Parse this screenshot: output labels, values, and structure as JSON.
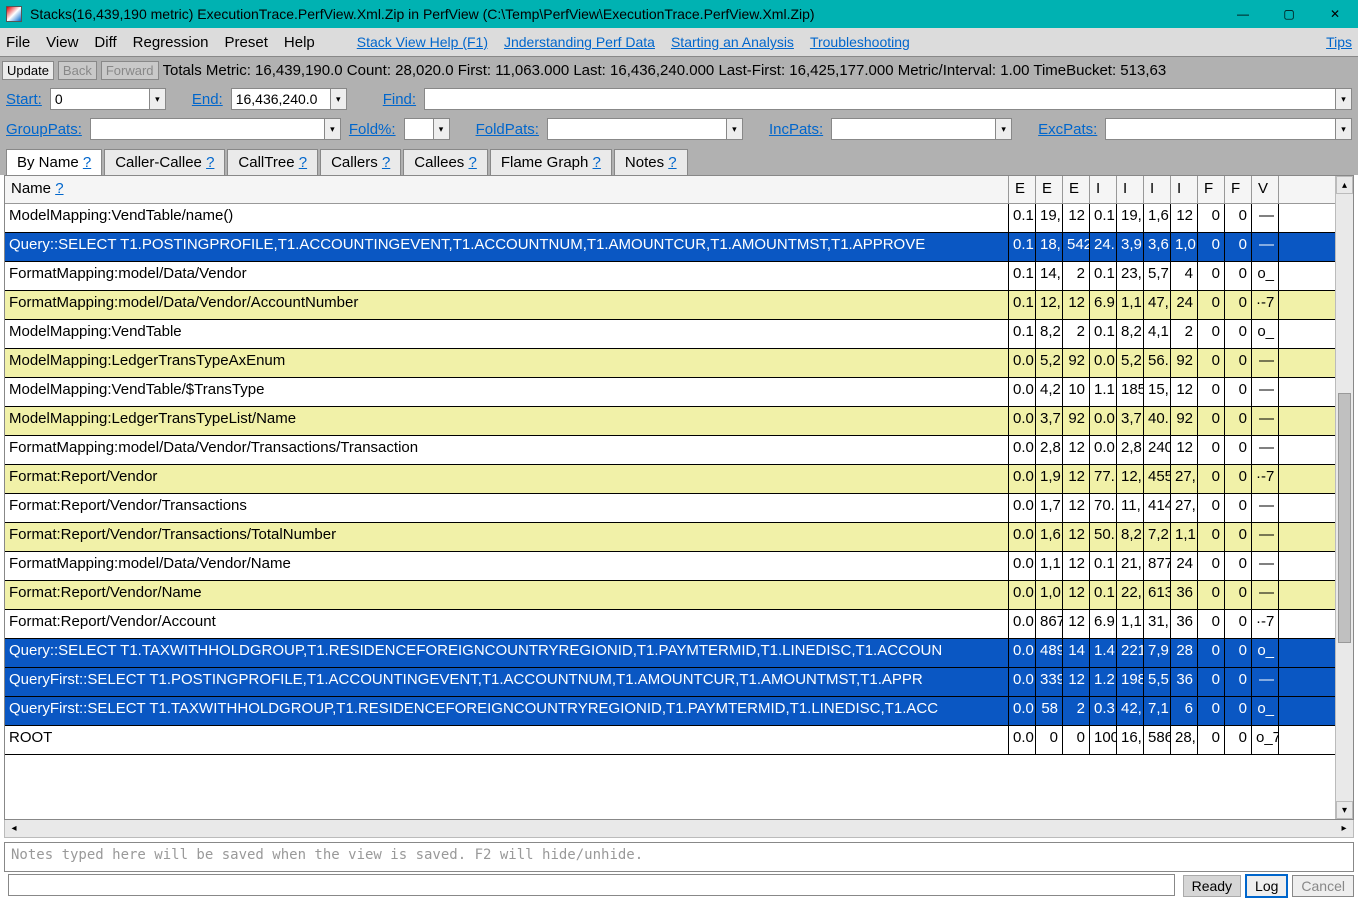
{
  "window": {
    "title": "Stacks(16,439,190 metric) ExecutionTrace.PerfView.Xml.Zip in PerfView (C:\\Temp\\PerfView\\ExecutionTrace.PerfView.Xml.Zip)"
  },
  "menu": {
    "file": "File",
    "view": "View",
    "diff": "Diff",
    "regression": "Regression",
    "preset": "Preset",
    "help": "Help",
    "links": {
      "stack": "Stack View Help (F1)",
      "understand": "Jnderstanding Perf Data",
      "starting": "Starting an Analysis",
      "trouble": "Troubleshooting",
      "tips": "Tips"
    }
  },
  "toolbar": {
    "update": "Update",
    "back": "Back",
    "forward": "Forward",
    "stats": "Totals Metric: 16,439,190.0   Count: 28,020.0   First: 11,063.000  Last: 16,436,240.000   Last-First: 16,425,177.000   Metric/Interval: 1.00   TimeBucket: 513,63"
  },
  "filters1": {
    "start_label": "Start:",
    "start_val": "0",
    "end_label": "End:",
    "end_val": "16,436,240.0",
    "find_label": "Find:",
    "find_val": ""
  },
  "filters2": {
    "group_label": "GroupPats:",
    "foldpct_label": "Fold%:",
    "foldpats_label": "FoldPats:",
    "incpats_label": "IncPats:",
    "excpats_label": "ExcPats:"
  },
  "tabs": {
    "byname": "By Name",
    "callercallee": "Caller-Callee",
    "calltree": "CallTree",
    "callers": "Callers",
    "callees": "Callees",
    "flame": "Flame Graph",
    "notes": "Notes",
    "q": "?"
  },
  "grid": {
    "headers": {
      "name": "Name",
      "q": "?",
      "c1": "E",
      "c2": "E",
      "c3": "E",
      "c4": "I",
      "c5": "I",
      "c6": "I",
      "c7": "I",
      "c8": "F",
      "c9": "F",
      "c10": "V"
    },
    "rows": [
      {
        "name": "ModelMapping:VendTable/name()",
        "c": [
          "0.1",
          "19,",
          "12",
          "0.1",
          "19,",
          "1,6",
          "12",
          "0",
          "0",
          "—"
        ],
        "alt": false,
        "sel": false
      },
      {
        "name": "Query::SELECT T1.POSTINGPROFILE,T1.ACCOUNTINGEVENT,T1.ACCOUNTNUM,T1.AMOUNTCUR,T1.AMOUNTMST,T1.APPROVE",
        "c": [
          "0.1",
          "18,",
          "542",
          "24.",
          "3,9",
          "3,6",
          "1,0",
          "0",
          "0",
          "—"
        ],
        "alt": true,
        "sel": true
      },
      {
        "name": "FormatMapping:model/Data/Vendor",
        "c": [
          "0.1",
          "14,",
          "2",
          "0.1",
          "23,",
          "5,7",
          "4",
          "0",
          "0",
          "o_"
        ],
        "alt": false,
        "sel": false
      },
      {
        "name": "FormatMapping:model/Data/Vendor/AccountNumber",
        "c": [
          "0.1",
          "12,",
          "12",
          "6.9",
          "1,1",
          "47,",
          "24",
          "0",
          "0",
          "·-7"
        ],
        "alt": true,
        "sel": false
      },
      {
        "name": "ModelMapping:VendTable",
        "c": [
          "0.1",
          "8,2",
          "2",
          "0.1",
          "8,2",
          "4,1",
          "2",
          "0",
          "0",
          "o_"
        ],
        "alt": false,
        "sel": false
      },
      {
        "name": "ModelMapping:LedgerTransTypeAxEnum",
        "c": [
          "0.0",
          "5,2",
          "92",
          "0.0",
          "5,2",
          "56.",
          "92",
          "0",
          "0",
          "—"
        ],
        "alt": true,
        "sel": false
      },
      {
        "name": "ModelMapping:VendTable/$TransType",
        "c": [
          "0.0",
          "4,2",
          "10",
          "1.1",
          "185",
          "15,",
          "12",
          "0",
          "0",
          "—"
        ],
        "alt": false,
        "sel": false
      },
      {
        "name": "ModelMapping:LedgerTransTypeList/Name",
        "c": [
          "0.0",
          "3,7",
          "92",
          "0.0",
          "3,7",
          "40.",
          "92",
          "0",
          "0",
          "—"
        ],
        "alt": true,
        "sel": false
      },
      {
        "name": "FormatMapping:model/Data/Vendor/Transactions/Transaction",
        "c": [
          "0.0",
          "2,8",
          "12",
          "0.0",
          "2,8",
          "240",
          "12",
          "0",
          "0",
          "—"
        ],
        "alt": false,
        "sel": false
      },
      {
        "name": "Format:Report/Vendor",
        "c": [
          "0.0",
          "1,9",
          "12",
          "77.",
          "12,",
          "455",
          "27,",
          "0",
          "0",
          "·-7"
        ],
        "alt": true,
        "sel": false
      },
      {
        "name": "Format:Report/Vendor/Transactions",
        "c": [
          "0.0",
          "1,7",
          "12",
          "70.",
          "11,",
          "414",
          "27,",
          "0",
          "0",
          "—"
        ],
        "alt": false,
        "sel": false
      },
      {
        "name": "Format:Report/Vendor/Transactions/TotalNumber",
        "c": [
          "0.0",
          "1,6",
          "12",
          "50.",
          "8,2",
          "7,2",
          "1,1",
          "0",
          "0",
          "—"
        ],
        "alt": true,
        "sel": false
      },
      {
        "name": "FormatMapping:model/Data/Vendor/Name",
        "c": [
          "0.0",
          "1,1",
          "12",
          "0.1",
          "21,",
          "877",
          "24",
          "0",
          "0",
          "—"
        ],
        "alt": false,
        "sel": false
      },
      {
        "name": "Format:Report/Vendor/Name",
        "c": [
          "0.0",
          "1,0",
          "12",
          "0.1",
          "22,",
          "613",
          "36",
          "0",
          "0",
          "—"
        ],
        "alt": true,
        "sel": false
      },
      {
        "name": "Format:Report/Vendor/Account",
        "c": [
          "0.0",
          "867",
          "12",
          "6.9",
          "1,1",
          "31,",
          "36",
          "0",
          "0",
          "·-7"
        ],
        "alt": false,
        "sel": false
      },
      {
        "name": "Query::SELECT T1.TAXWITHHOLDGROUP,T1.RESIDENCEFOREIGNCOUNTRYREGIONID,T1.PAYMTERMID,T1.LINEDISC,T1.ACCOUN",
        "c": [
          "0.0",
          "489",
          "14",
          "1.4",
          "221",
          "7,9",
          "28",
          "0",
          "0",
          "o_"
        ],
        "alt": true,
        "sel": true
      },
      {
        "name": "QueryFirst::SELECT T1.POSTINGPROFILE,T1.ACCOUNTINGEVENT,T1.ACCOUNTNUM,T1.AMOUNTCUR,T1.AMOUNTMST,T1.APPR",
        "c": [
          "0.0",
          "339",
          "12",
          "1.2",
          "198",
          "5,5",
          "36",
          "0",
          "0",
          "—"
        ],
        "alt": false,
        "sel": true
      },
      {
        "name": "QueryFirst::SELECT T1.TAXWITHHOLDGROUP,T1.RESIDENCEFOREIGNCOUNTRYREGIONID,T1.PAYMTERMID,T1.LINEDISC,T1.ACC",
        "c": [
          "0.0",
          "58",
          "2",
          "0.3",
          "42,",
          "7,1",
          "6",
          "0",
          "0",
          "o_"
        ],
        "alt": true,
        "sel": true
      },
      {
        "name": "ROOT",
        "c": [
          "0.0",
          "0",
          "0",
          "100",
          "16,",
          "586",
          "28,",
          "0",
          "0",
          "o_7"
        ],
        "alt": false,
        "sel": false
      }
    ]
  },
  "notes": {
    "placeholder": "Notes typed here will be saved when the view is saved.  F2 will hide/unhide."
  },
  "status": {
    "ready": "Ready",
    "log": "Log",
    "cancel": "Cancel"
  }
}
